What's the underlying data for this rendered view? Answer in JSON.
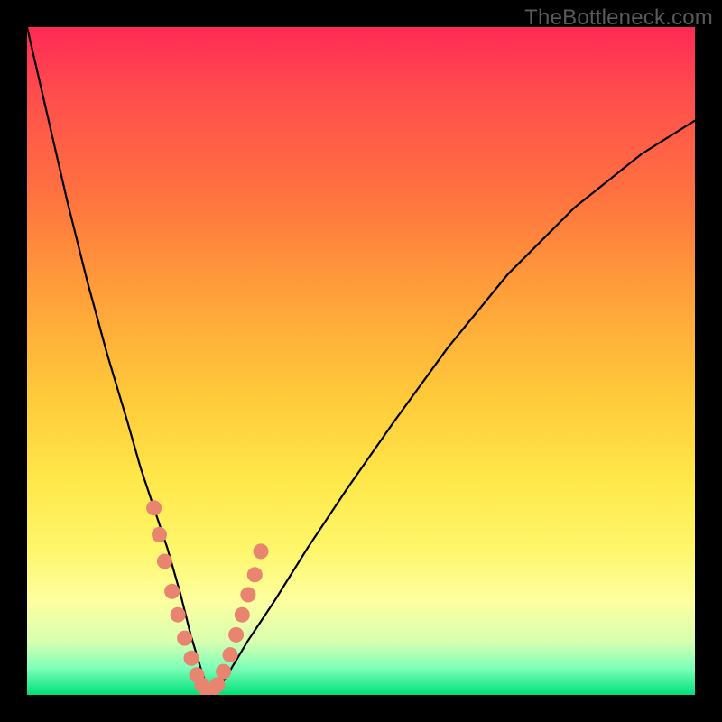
{
  "watermark": "TheBottleneck.com",
  "colors": {
    "frame": "#000000",
    "gradient_top": "#ff2a55",
    "gradient_bottom": "#00e07a",
    "curve": "#000000",
    "dots": "#e8846f"
  },
  "chart_data": {
    "type": "line",
    "title": "",
    "xlabel": "",
    "ylabel": "",
    "xlim": [
      0,
      100
    ],
    "ylim": [
      0,
      100
    ],
    "note": "Bottleneck-style V-curve; axes unlabeled. Values estimated from pixel positions.",
    "series": [
      {
        "name": "curve",
        "x": [
          0,
          3,
          6,
          9,
          12,
          15,
          17,
          19,
          21,
          23,
          24.5,
          26,
          27,
          28,
          30,
          33,
          37,
          42,
          48,
          55,
          63,
          72,
          82,
          92,
          100
        ],
        "y": [
          100,
          87,
          74,
          62,
          51,
          41,
          34,
          28,
          22,
          15,
          9,
          4,
          1,
          0,
          3,
          8,
          14,
          22,
          31,
          41,
          52,
          63,
          73,
          81,
          86
        ]
      }
    ],
    "dots": {
      "name": "highlighted-band",
      "x": [
        19.0,
        19.8,
        20.6,
        21.7,
        22.6,
        23.6,
        24.6,
        25.4,
        26.2,
        27.0,
        27.6,
        28.5,
        29.4,
        30.4,
        31.3,
        32.2,
        33.1,
        34.1,
        35.0
      ],
      "y": [
        28.0,
        24.0,
        20.0,
        15.5,
        12.0,
        8.5,
        5.5,
        3.0,
        1.5,
        0.5,
        0.5,
        1.5,
        3.5,
        6.0,
        9.0,
        12.0,
        15.0,
        18.0,
        21.5
      ]
    }
  }
}
